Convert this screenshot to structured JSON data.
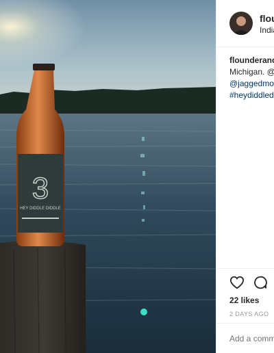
{
  "post": {
    "username": "flounderandpi",
    "location": "Indian River, Michigan",
    "caption": {
      "username": "flounderandpi",
      "line1": "Michigan. @",
      "line2": "@jaggedmountain",
      "line3": "#heydiddlediddle"
    },
    "likes": "22 likes",
    "time_ago": "2 DAYS AGO",
    "comment_placeholder": "Add a comment...",
    "icons": [
      "heart-icon",
      "comment-icon"
    ]
  },
  "photo": {
    "bottle_number": "3",
    "bottle_label": "HEY DIDDLE DIDDLE"
  }
}
